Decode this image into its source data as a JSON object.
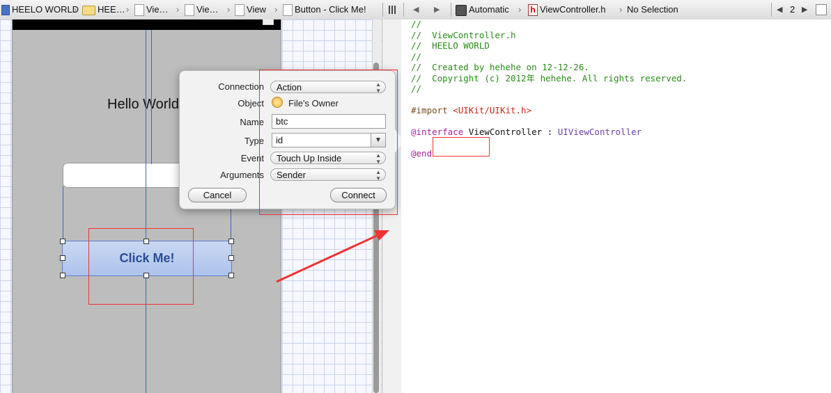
{
  "jumpbar": {
    "crumbs": [
      "HEELO WORLD",
      "HEE…",
      "Vie…",
      "Vie…",
      "View",
      "Button - Click Me!"
    ],
    "right_crumbs": [
      "Automatic",
      "ViewController.h",
      "No Selection"
    ],
    "counter": "2",
    "counter_prev": "◀",
    "counter_next": "▶"
  },
  "canvas": {
    "hello_label": "Hello World",
    "button_label": "Click Me!"
  },
  "popover": {
    "connection_label": "Connection",
    "connection_value": "Action",
    "object_label": "Object",
    "object_value": "File's Owner",
    "name_label": "Name",
    "name_value": "btc",
    "type_label": "Type",
    "type_value": "id",
    "event_label": "Event",
    "event_value": "Touch Up Inside",
    "arguments_label": "Arguments",
    "arguments_value": "Sender",
    "cancel": "Cancel",
    "connect": "Connect"
  },
  "editor": {
    "lines": [
      "//",
      "//  ViewController.h",
      "//  HEELO WORLD",
      "//",
      "//  Created by hehehe on 12-12-26.",
      "//  Copyright (c) 2012年 hehehe. All rights reserved.",
      "//"
    ],
    "import_kw": "#import ",
    "import_path": "<UIKit/UIKit.h>",
    "interface_kw": "@interface",
    "interface_class": " ViewController : ",
    "interface_super": "UIViewController",
    "end_kw": "@end"
  },
  "colors": {
    "annotation": "#e33333",
    "comment": "#2a8a19",
    "keyword": "#a5229b",
    "string": "#c4291a"
  },
  "icons": [
    "folder-icon",
    "document-icon",
    "header-file-icon",
    "grid-icon",
    "related-items-icon",
    "files-owner-icon"
  ]
}
